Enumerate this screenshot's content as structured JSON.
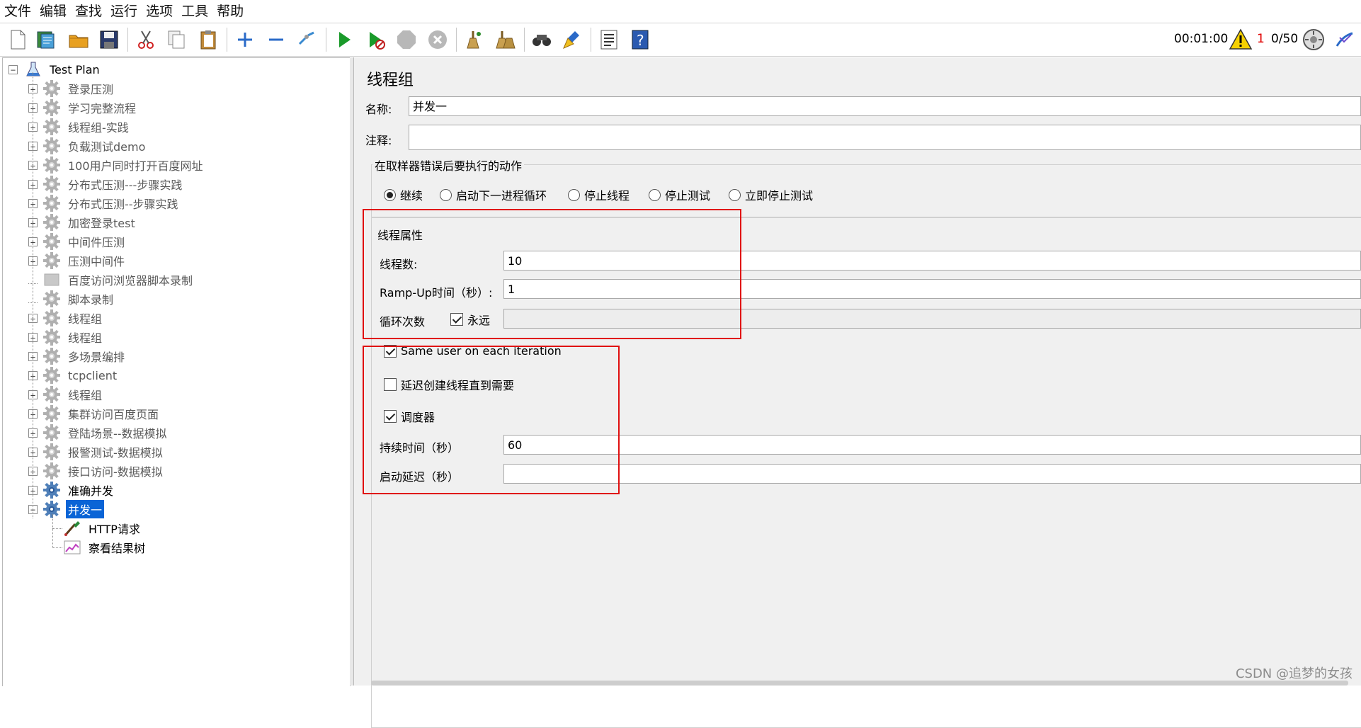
{
  "menu": [
    "文件",
    "编辑",
    "查找",
    "运行",
    "选项",
    "工具",
    "帮助"
  ],
  "toolbar": {
    "buttons": [
      "new-icon",
      "templates-icon",
      "open-icon",
      "save-icon",
      "cut-icon",
      "copy-icon",
      "paste-icon",
      "expand-icon",
      "collapse-icon",
      "toggle-icon",
      "start-icon",
      "start-no-pause-icon",
      "stop-icon",
      "shutdown-icon",
      "clear-icon",
      "clear-all-icon",
      "search-icon",
      "reset-search-icon",
      "function-helper-icon",
      "help-icon"
    ],
    "timer": "00:01:00",
    "warning_count": "1",
    "thread_count": "0/50"
  },
  "tree": {
    "root": "Test Plan",
    "items": [
      {
        "label": "登录压测",
        "enabled": false,
        "expandable": true
      },
      {
        "label": "学习完整流程",
        "enabled": false,
        "expandable": true
      },
      {
        "label": "线程组-实践",
        "enabled": false,
        "expandable": true
      },
      {
        "label": "负载测试demo",
        "enabled": false,
        "expandable": true
      },
      {
        "label": "100用户同时打开百度网址",
        "enabled": false,
        "expandable": true
      },
      {
        "label": "分布式压测---步骤实践",
        "enabled": false,
        "expandable": true
      },
      {
        "label": "分布式压测--步骤实践",
        "enabled": false,
        "expandable": true
      },
      {
        "label": "加密登录test",
        "enabled": false,
        "expandable": true
      },
      {
        "label": "中间件压测",
        "enabled": false,
        "expandable": true
      },
      {
        "label": "压测中间件",
        "enabled": false,
        "expandable": true
      },
      {
        "label": "百度访问浏览器脚本录制",
        "enabled": false,
        "expandable": false
      },
      {
        "label": "脚本录制",
        "enabled": false,
        "expandable": false
      },
      {
        "label": "线程组",
        "enabled": false,
        "expandable": true
      },
      {
        "label": "线程组",
        "enabled": false,
        "expandable": true
      },
      {
        "label": "多场景编排",
        "enabled": false,
        "expandable": true
      },
      {
        "label": "tcpclient",
        "enabled": false,
        "expandable": true
      },
      {
        "label": "线程组",
        "enabled": false,
        "expandable": true
      },
      {
        "label": "集群访问百度页面",
        "enabled": false,
        "expandable": true
      },
      {
        "label": "登陆场景--数据模拟",
        "enabled": false,
        "expandable": true
      },
      {
        "label": "报警测试-数据模拟",
        "enabled": false,
        "expandable": true
      },
      {
        "label": "接口访问-数据模拟",
        "enabled": false,
        "expandable": true
      },
      {
        "label": "准确并发",
        "enabled": true,
        "expandable": true
      },
      {
        "label": "并发一",
        "enabled": true,
        "expandable": true,
        "selected": true
      }
    ],
    "children": [
      {
        "label": "HTTP请求",
        "icon": "http-sampler-icon"
      },
      {
        "label": "察看结果树",
        "icon": "result-tree-icon"
      }
    ]
  },
  "panel": {
    "title": "线程组",
    "name_label": "名称:",
    "name_value": "并发一",
    "comment_label": "注释:",
    "comment_value": "",
    "error_action": {
      "title": "在取样器错误后要执行的动作",
      "options": [
        "继续",
        "启动下一进程循环",
        "停止线程",
        "停止测试",
        "立即停止测试"
      ],
      "selected": 0
    },
    "thread_props": {
      "title": "线程属性",
      "threads_label": "线程数:",
      "threads_value": "10",
      "rampup_label": "Ramp-Up时间（秒）:",
      "rampup_value": "1",
      "loop_label": "循环次数",
      "forever_label": "永远",
      "forever_checked": true,
      "loop_value": ""
    },
    "same_user_label": "Same user on each iteration",
    "same_user_checked": true,
    "delay_create_label": "延迟创建线程直到需要",
    "delay_create_checked": false,
    "scheduler_label": "调度器",
    "scheduler_checked": true,
    "duration_label": "持续时间（秒）",
    "duration_value": "60",
    "startup_delay_label": "启动延迟（秒）",
    "startup_delay_value": ""
  },
  "watermark": "CSDN @追梦的女孩",
  "colors": {
    "selection": "#0a64d6",
    "highlight_box": "#e01010",
    "warning": "#e00000"
  }
}
